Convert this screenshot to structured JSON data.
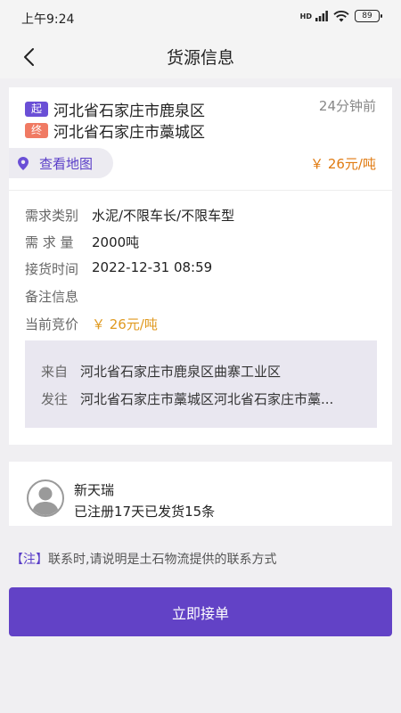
{
  "status_bar": {
    "time": "上午9:24",
    "signal_label": "HD",
    "battery": "89"
  },
  "nav": {
    "title": "货源信息"
  },
  "route": {
    "start_tag": "起",
    "start": "河北省石家庄市鹿泉区",
    "end_tag": "终",
    "end": "河北省石家庄市藁城区",
    "time_ago": "24分钟前"
  },
  "map_button": {
    "label": "查看地图"
  },
  "price_display": "￥ 26元/吨",
  "details": [
    {
      "label": "需求类别",
      "value": "水泥/不限车长/不限车型"
    },
    {
      "label": "需 求 量",
      "value": "2000吨"
    },
    {
      "label": "接货时间",
      "value": "2022-12-31 08:59"
    },
    {
      "label": "备注信息",
      "value": ""
    },
    {
      "label": "当前竞价",
      "value": "￥ 26元/吨"
    }
  ],
  "addresses": {
    "from_label": "来自",
    "from": "河北省石家庄市鹿泉区曲寨工业区",
    "to_label": "发往",
    "to": "河北省石家庄市藁城区河北省石家庄市藁..."
  },
  "shipper": {
    "name": "新天瑞",
    "stats": "已注册17天已发货15条"
  },
  "note": {
    "tag": "【注】",
    "text": "联系时,请说明是土石物流提供的联系方式"
  },
  "accept_button": {
    "label": "立即接单"
  },
  "colors": {
    "primary": "#6242c6",
    "price": "#e07a10",
    "end_tag": "#f07a63"
  }
}
